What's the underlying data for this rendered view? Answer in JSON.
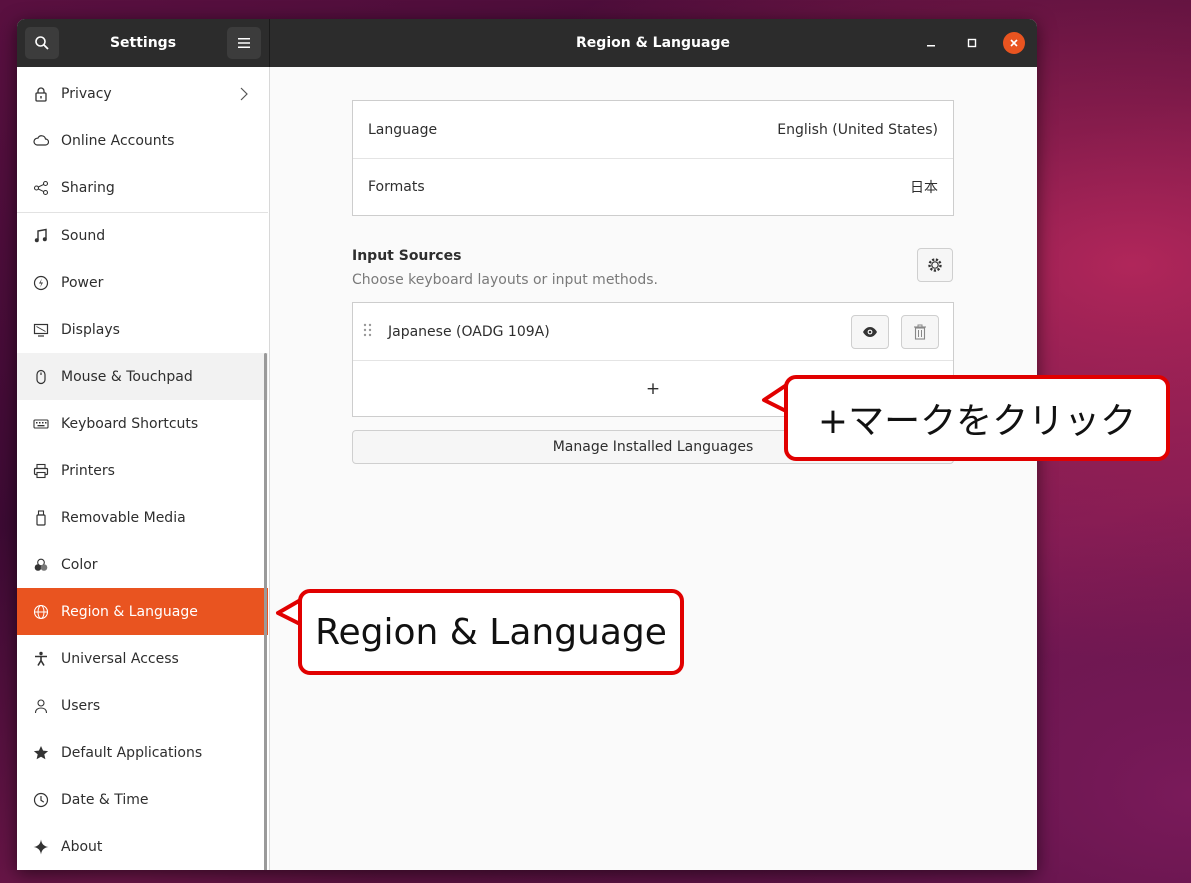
{
  "header": {
    "sidebar_title": "Settings",
    "main_title": "Region & Language"
  },
  "sidebar": {
    "items": [
      {
        "label": "Privacy",
        "icon": "lock-icon"
      },
      {
        "label": "Online Accounts",
        "icon": "cloud-icon"
      },
      {
        "label": "Sharing",
        "icon": "share-icon"
      },
      {
        "label": "Sound",
        "icon": "music-note-icon"
      },
      {
        "label": "Power",
        "icon": "power-icon"
      },
      {
        "label": "Displays",
        "icon": "display-icon"
      },
      {
        "label": "Mouse & Touchpad",
        "icon": "mouse-icon"
      },
      {
        "label": "Keyboard Shortcuts",
        "icon": "keyboard-icon"
      },
      {
        "label": "Printers",
        "icon": "printer-icon"
      },
      {
        "label": "Removable Media",
        "icon": "usb-drive-icon"
      },
      {
        "label": "Color",
        "icon": "color-circles-icon"
      },
      {
        "label": "Region & Language",
        "icon": "globe-icon"
      },
      {
        "label": "Universal Access",
        "icon": "accessibility-icon"
      },
      {
        "label": "Users",
        "icon": "users-icon"
      },
      {
        "label": "Default Applications",
        "icon": "star-icon"
      },
      {
        "label": "Date & Time",
        "icon": "clock-icon"
      },
      {
        "label": "About",
        "icon": "sparkle-icon"
      }
    ],
    "active": "Region & Language"
  },
  "main": {
    "language": {
      "label": "Language",
      "value": "English (United States)"
    },
    "formats": {
      "label": "Formats",
      "value": "日本"
    },
    "input_sources": {
      "title": "Input Sources",
      "subtitle": "Choose keyboard layouts or input methods.",
      "items": [
        {
          "label": "Japanese (OADG 109A)"
        }
      ],
      "add_label": "+"
    },
    "manage_label": "Manage Installed Languages"
  },
  "annotations": {
    "plus_callout": "+マークをクリック",
    "region_callout": "Region & Language"
  },
  "colors": {
    "accent": "#e95420",
    "callout_border": "#e10000",
    "headerbar": "#2c2c2c"
  }
}
